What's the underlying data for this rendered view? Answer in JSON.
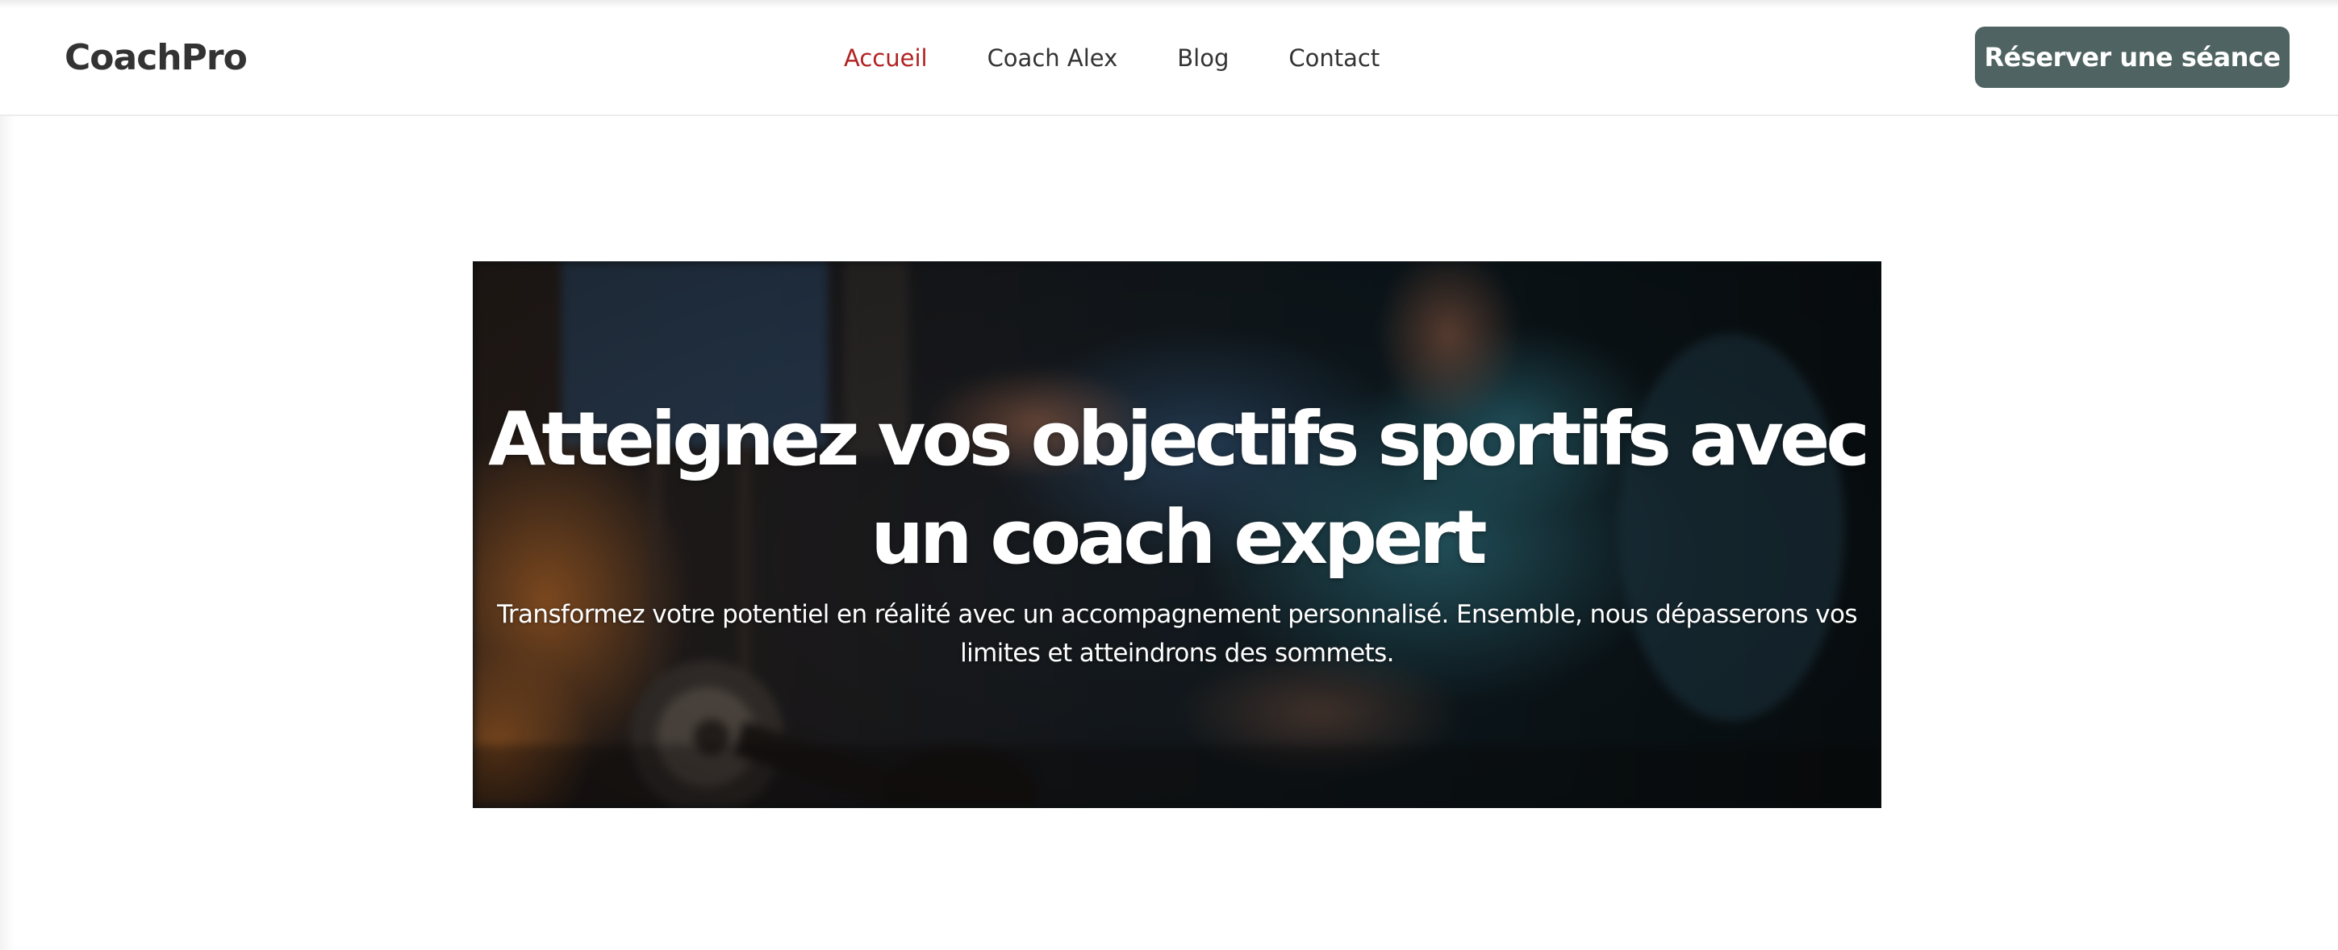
{
  "header": {
    "logo": "CoachPro",
    "nav": [
      {
        "label": "Accueil",
        "active": true
      },
      {
        "label": "Coach Alex",
        "active": false
      },
      {
        "label": "Blog",
        "active": false
      },
      {
        "label": "Contact",
        "active": false
      }
    ],
    "cta_label": "Réserver une séance"
  },
  "hero": {
    "title": "Atteignez vos objectifs sportifs avec un coach expert",
    "subtitle": "Transformez votre potentiel en réalité avec un accompagnement personnalisé. Ensemble, nous dépasserons vos limites et atteindrons des sommets.",
    "background_image": "gym-training-photo"
  },
  "colors": {
    "nav_active": "#b22222",
    "nav_text": "#333333",
    "cta_background": "#4f6462",
    "cta_text": "#ffffff",
    "hero_text": "#ffffff"
  }
}
